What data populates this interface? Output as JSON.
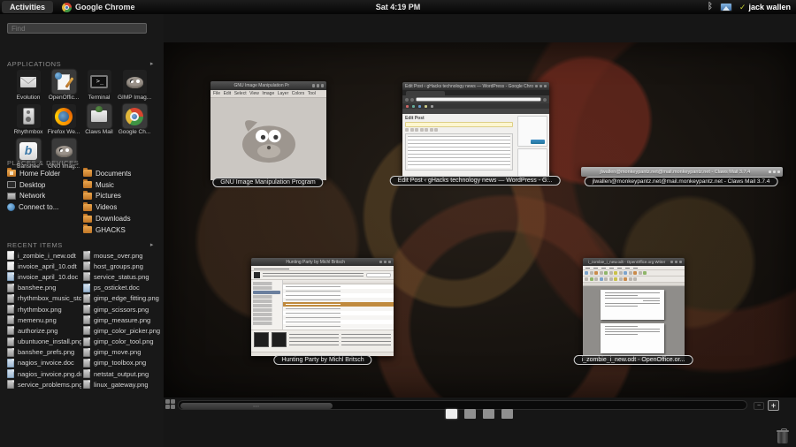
{
  "topbar": {
    "activities_label": "Activities",
    "focused_app": "Google Chrome",
    "clock": "Sat  4:19 PM",
    "check_mark": "✓",
    "username": "jack wallen",
    "bluetooth_glyph": "ᛒ"
  },
  "search": {
    "placeholder": "Find"
  },
  "applications": {
    "title": "APPLICATIONS",
    "expand_arrow": "▸",
    "items": [
      {
        "label": "Evolution",
        "icon": "evolution",
        "running": false
      },
      {
        "label": "OpenOffic...",
        "icon": "openoffice",
        "running": true
      },
      {
        "label": "Terminal",
        "icon": "terminal",
        "running": false
      },
      {
        "label": "GIMP Imag...",
        "icon": "gimp",
        "running": false
      },
      {
        "label": "Rhythmbox",
        "icon": "rhythmbox",
        "running": false
      },
      {
        "label": "Firefox We...",
        "icon": "firefox",
        "running": false
      },
      {
        "label": "Claws Mail",
        "icon": "claws",
        "running": true
      },
      {
        "label": "Google Ch...",
        "icon": "chrome",
        "running": true
      },
      {
        "label": "Banshee",
        "icon": "banshee",
        "running": true
      },
      {
        "label": "GNU Imag...",
        "icon": "gimp",
        "running": true
      }
    ]
  },
  "places": {
    "title": "PLACES & DEVICES",
    "left": [
      {
        "label": "Home Folder",
        "icon": "home"
      },
      {
        "label": "Desktop",
        "icon": "desktop"
      },
      {
        "label": "Network",
        "icon": "network"
      },
      {
        "label": "Connect to...",
        "icon": "globe"
      }
    ],
    "right": [
      {
        "label": "Documents",
        "icon": "folder"
      },
      {
        "label": "Music",
        "icon": "folder"
      },
      {
        "label": "Pictures",
        "icon": "folder"
      },
      {
        "label": "Videos",
        "icon": "folder"
      },
      {
        "label": "Downloads",
        "icon": "folder"
      },
      {
        "label": "GHACKS",
        "icon": "folder"
      }
    ]
  },
  "recent": {
    "title": "RECENT ITEMS",
    "expand_arrow": "▸",
    "col1": [
      "i_zombie_i_new.odt",
      "invoice_april_10.odt",
      "invoice_april_10.doc",
      "banshee.png",
      "rhythmbox_music_stor...",
      "rhythmbox.png",
      "memenu.png",
      "authorize.png",
      "ubuntuone_install.png",
      "banshee_prefs.png",
      "nagios_invoice.doc",
      "nagios_invoice.png.doc",
      "service_problems.png"
    ],
    "col2": [
      "mouse_over.png",
      "host_groups.png",
      "service_status.png",
      "ps_osticket.doc",
      "gimp_edge_fitting.png",
      "gimp_scissors.png",
      "gimp_measure.png",
      "gimp_color_picker.png",
      "gimp_color_tool.png",
      "gimp_move.png",
      "gimp_toolbox.png",
      "netstat_output.png",
      "linux_gateway.png"
    ]
  },
  "windows": {
    "gimp": {
      "title": "GNU Image Manipulation Pr",
      "menu": [
        "File",
        "Edit",
        "Select",
        "View",
        "Image",
        "Layer",
        "Colors",
        "Tool"
      ],
      "caption": "GNU Image Manipulation Program"
    },
    "chrome": {
      "title": "Edit Post ‹ gHacks technology news — WordPress - Google Chrome",
      "page_heading": "Edit Post",
      "caption": "Edit Post ‹ gHacks technology news — WordPress - G..."
    },
    "claws": {
      "title": "jlwallen@monkeypantz.net@mail.monkeypantz.net - Claws Mail 3.7.4",
      "caption": "jlwallen@monkeypantz.net@mail.monkeypantz.net - Claws Mail 3.7.4"
    },
    "banshee": {
      "title": "Hunting Party by Michl Britsch",
      "caption": "Hunting Party by Michl Britsch"
    },
    "writer": {
      "title": "i_zombie_i_new.odt - OpenOffice.org Writer",
      "caption": "i_zombie_i_new.odt - OpenOffice.or..."
    }
  },
  "workspace_controls": {
    "indicator_count": 4,
    "active_index": 0,
    "remove_label": "−",
    "add_label": "+"
  },
  "colors": {
    "accent_user_check": "#c2cc33",
    "running_tile": "#3a3a3a",
    "caption_border": "#cfcfcf"
  }
}
